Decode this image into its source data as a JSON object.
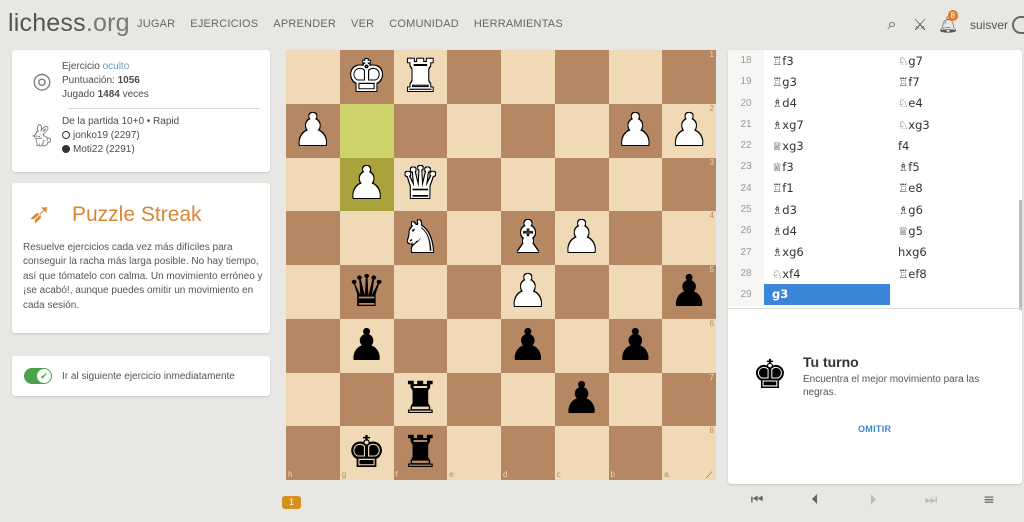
{
  "header": {
    "logo_main": "lichess",
    "logo_tld": ".org",
    "nav": [
      "JUGAR",
      "EJERCICIOS",
      "APRENDER",
      "VER",
      "COMUNIDAD",
      "HERRAMIENTAS"
    ],
    "notification_count": "8",
    "username": "suisver"
  },
  "puzzle_info": {
    "label_exercise": "Ejercicio",
    "exercise_status": "oculto",
    "score_label": "Puntuación:",
    "score_value": "1056",
    "played_prefix": "Jugado",
    "played_count": "1484",
    "played_suffix": "veces",
    "from_game": "De la partida 10+0 • Rapid",
    "white_player": "jonko19 (2297)",
    "black_player": "Moti22 (2291)"
  },
  "streak": {
    "title": "Puzzle Streak",
    "description": "Resuelve ejercicios cada vez más difíciles para conseguir la racha más larga posible. No hay tiempo, así que tómatelo con calma. Un movimiento erróneo y ¡se acabó!, aunque puedes omitir un movimiento en cada sesión."
  },
  "toggle": {
    "label": "Ir al siguiente ejercicio inmediatamente",
    "enabled": true
  },
  "board": {
    "orientation": "black",
    "rank_labels": [
      "1",
      "2",
      "3",
      "4",
      "5",
      "6",
      "7",
      "8"
    ],
    "file_labels": [
      "h",
      "g",
      "f",
      "e",
      "d",
      "c",
      "b",
      "a"
    ],
    "highlight_squares": [
      "g2",
      "g3"
    ],
    "rows": [
      [
        "",
        "bK_w",
        "bR_w",
        "",
        "",
        "",
        "",
        ""
      ],
      [
        "P_w",
        "",
        "",
        "",
        "",
        "",
        "P_w",
        "P_w"
      ],
      [
        "",
        "P_w",
        "Q_w",
        "",
        "",
        "",
        "",
        ""
      ],
      [
        "",
        "",
        "N_w",
        "",
        "B_w",
        "P_w",
        "",
        ""
      ],
      [
        "",
        "Q_b",
        "",
        "",
        "P_w",
        "",
        "",
        "P_b"
      ],
      [
        "",
        "P_b",
        "",
        "",
        "P_b",
        "",
        "P_b",
        ""
      ],
      [
        "",
        "",
        "R_b",
        "",
        "",
        "P_b",
        "",
        ""
      ],
      [
        "",
        "K_b",
        "R_b",
        "",
        "",
        "",
        "",
        ""
      ]
    ],
    "move_counter": "1"
  },
  "moves": [
    {
      "n": "18",
      "w": "♖f3",
      "b": "♘g7"
    },
    {
      "n": "19",
      "w": "♖g3",
      "b": "♖f7"
    },
    {
      "n": "20",
      "w": "♗d4",
      "b": "♘e4"
    },
    {
      "n": "21",
      "w": "♗xg7",
      "b": "♘xg3"
    },
    {
      "n": "22",
      "w": "♕xg3",
      "b": "f4"
    },
    {
      "n": "23",
      "w": "♕f3",
      "b": "♗f5"
    },
    {
      "n": "24",
      "w": "♖f1",
      "b": "♖e8"
    },
    {
      "n": "25",
      "w": "♗d3",
      "b": "♗g6"
    },
    {
      "n": "26",
      "w": "♗d4",
      "b": "♕g5"
    },
    {
      "n": "27",
      "w": "♗xg6",
      "b": "hxg6"
    },
    {
      "n": "28",
      "w": "♘xf4",
      "b": "♖ef8"
    },
    {
      "n": "29",
      "w": "g3",
      "b": ""
    }
  ],
  "turn": {
    "title": "Tu turno",
    "description": "Encuentra el mejor movimiento para las negras.",
    "skip": "OMITIR"
  },
  "controls": [
    "⏮",
    "⏴",
    "⏵",
    "⏭",
    "≡"
  ]
}
